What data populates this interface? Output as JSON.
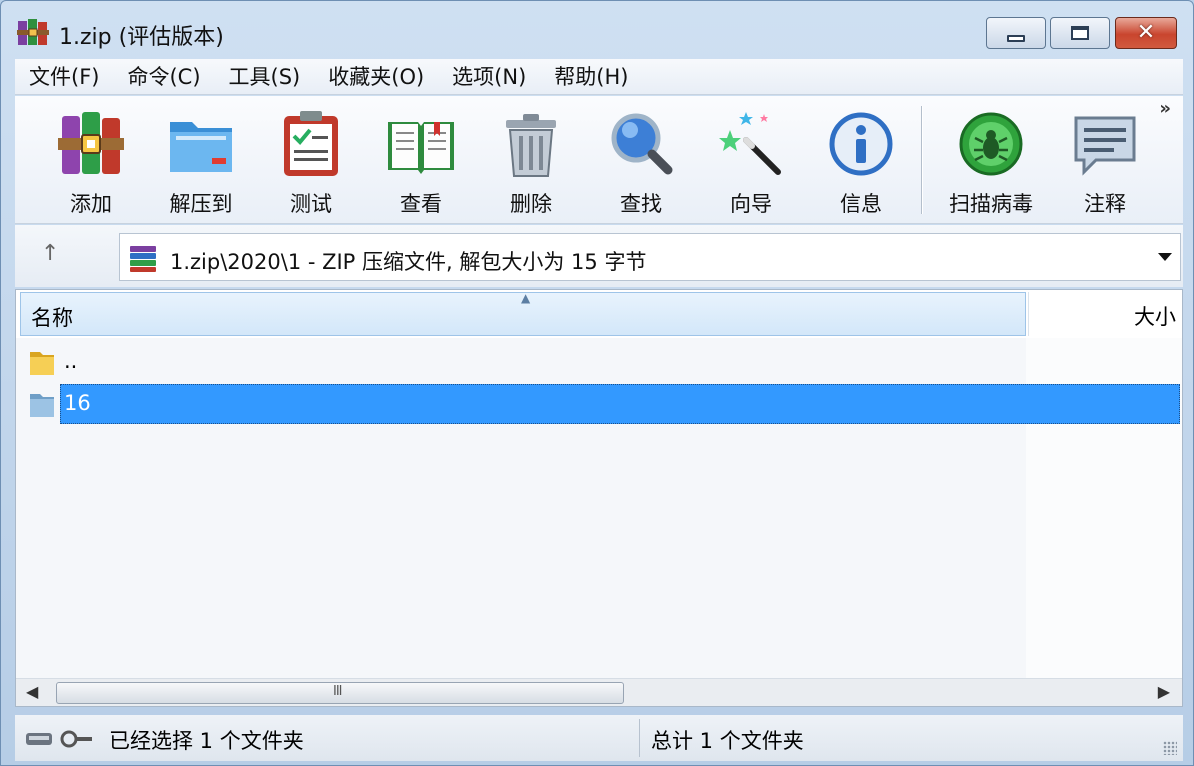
{
  "window": {
    "title": "1.zip (评估版本)"
  },
  "menu": [
    {
      "label": "文件(F)"
    },
    {
      "label": "命令(C)"
    },
    {
      "label": "工具(S)"
    },
    {
      "label": "收藏夹(O)"
    },
    {
      "label": "选项(N)"
    },
    {
      "label": "帮助(H)"
    }
  ],
  "toolbar": {
    "buttons": [
      {
        "label": "添加",
        "icon": "winrar-books-icon"
      },
      {
        "label": "解压到",
        "icon": "folder-extract-icon"
      },
      {
        "label": "测试",
        "icon": "clipboard-check-icon"
      },
      {
        "label": "查看",
        "icon": "open-book-icon"
      },
      {
        "label": "删除",
        "icon": "trash-can-icon"
      },
      {
        "label": "查找",
        "icon": "magnifier-icon"
      },
      {
        "label": "向导",
        "icon": "magic-wand-icon"
      },
      {
        "label": "信息",
        "icon": "info-icon"
      },
      {
        "label": "扫描病毒",
        "icon": "virus-scan-icon"
      },
      {
        "label": "注释",
        "icon": "comment-icon"
      }
    ],
    "overflow": "»"
  },
  "address": {
    "up": "↑",
    "path": "1.zip\\2020\\1 - ZIP 压缩文件, 解包大小为 15 字节"
  },
  "columns": {
    "name": "名称",
    "size": "大小"
  },
  "files": [
    {
      "name": "..",
      "selected": false
    },
    {
      "name": "16",
      "selected": true
    }
  ],
  "scrollbar": {
    "left": "◀",
    "right": "▶",
    "grip": "III"
  },
  "status": {
    "left": "已经选择 1 个文件夹",
    "right": "总计 1 个文件夹"
  },
  "colors": {
    "selection": "#3399ff",
    "header": "#d3e7f9",
    "close_button": "#c9452e"
  }
}
